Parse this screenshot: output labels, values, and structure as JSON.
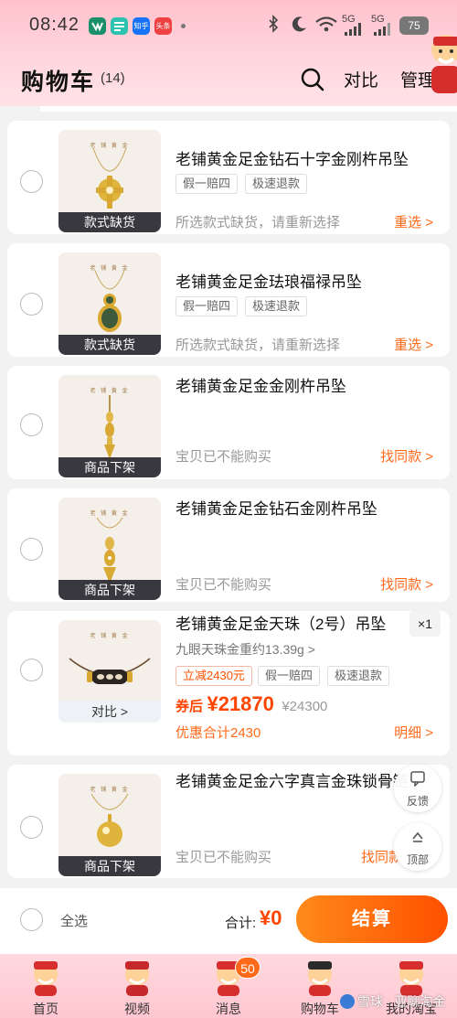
{
  "status_bar": {
    "time": "08:42",
    "app_chips": [
      {
        "name": "app-icon-1",
        "text": "",
        "color": "#1a8f6a"
      },
      {
        "name": "app-icon-2",
        "text": "",
        "color": "#2ec2b0"
      },
      {
        "name": "zhihu-icon",
        "text": "知乎",
        "color": "#1772f6"
      },
      {
        "name": "app-icon-4",
        "text": "头条",
        "color": "#f04142"
      }
    ],
    "signal_1": "5G",
    "signal_2": "5G",
    "battery": "75"
  },
  "header": {
    "title": "购物车",
    "count": "(14)",
    "compare_label": "对比",
    "manage_label": "管理"
  },
  "items": [
    {
      "name": "老铺黄金足金钻石十字金刚杵吊坠",
      "tags": [
        "假一赔四",
        "极速退款"
      ],
      "overlay": "款式缺货",
      "status": "所选款式缺货，请重新选择",
      "action": "重选 >"
    },
    {
      "name": "老铺黄金足金珐琅福禄吊坠",
      "tags": [
        "假一赔四",
        "极速退款"
      ],
      "overlay": "款式缺货",
      "status": "所选款式缺货，请重新选择",
      "action": "重选 >"
    },
    {
      "name": "老铺黄金足金金刚杵吊坠",
      "overlay": "商品下架",
      "status": "宝贝已不能购买",
      "action": "找同款 >"
    },
    {
      "name": "老铺黄金足金钻石金刚杵吊坠",
      "overlay": "商品下架",
      "status": "宝贝已不能购买",
      "action": "找同款 >"
    },
    {
      "name": "老铺黄金足金天珠（2号）吊坠",
      "quantity": "×1",
      "spec": "九眼天珠金重约13.39g >",
      "tags": [
        "立减2430元",
        "假一赔四",
        "极速退款"
      ],
      "price_label": "券后",
      "price": "¥21870",
      "original_price": "¥24300",
      "discount": "优惠合计2430",
      "detail_action": "明细 >",
      "compare_label": "对比 >"
    },
    {
      "name": "老铺黄金足金六字真言金珠锁骨链",
      "overlay": "商品下架",
      "status": "宝贝已不能购买",
      "action": "找同款"
    }
  ],
  "floating": {
    "feedback_label": "反馈",
    "top_label": "顶部"
  },
  "checkout": {
    "select_all": "全选",
    "total_label": "合计:",
    "total_value": "¥0",
    "button_label": "结算"
  },
  "tabbar": {
    "tabs": [
      "首页",
      "视频",
      "消息",
      "购物车",
      "我的淘宝"
    ],
    "message_badge": "50"
  },
  "watermark": "雪球 · 亚聊淘金"
}
